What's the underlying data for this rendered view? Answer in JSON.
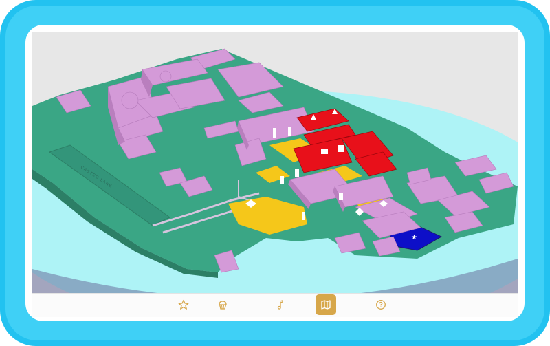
{
  "map": {
    "street_label": "CASTRO LANE",
    "colors": {
      "water": "#aef3f6",
      "ground": "#3aa685",
      "building": "#d49ad8",
      "highlight_red": "#e8101a",
      "courtyard_yellow": "#f5c71a",
      "pool_blue": "#0d0fc8"
    }
  },
  "tabbar": {
    "tabs": [
      {
        "icon": "star-icon",
        "active": false
      },
      {
        "icon": "cupcake-icon",
        "active": false
      },
      {
        "icon": "music-note-icon",
        "active": false
      },
      {
        "icon": "map-icon",
        "active": true
      },
      {
        "icon": "help-icon",
        "active": false
      }
    ],
    "accent": "#d7a74a"
  }
}
